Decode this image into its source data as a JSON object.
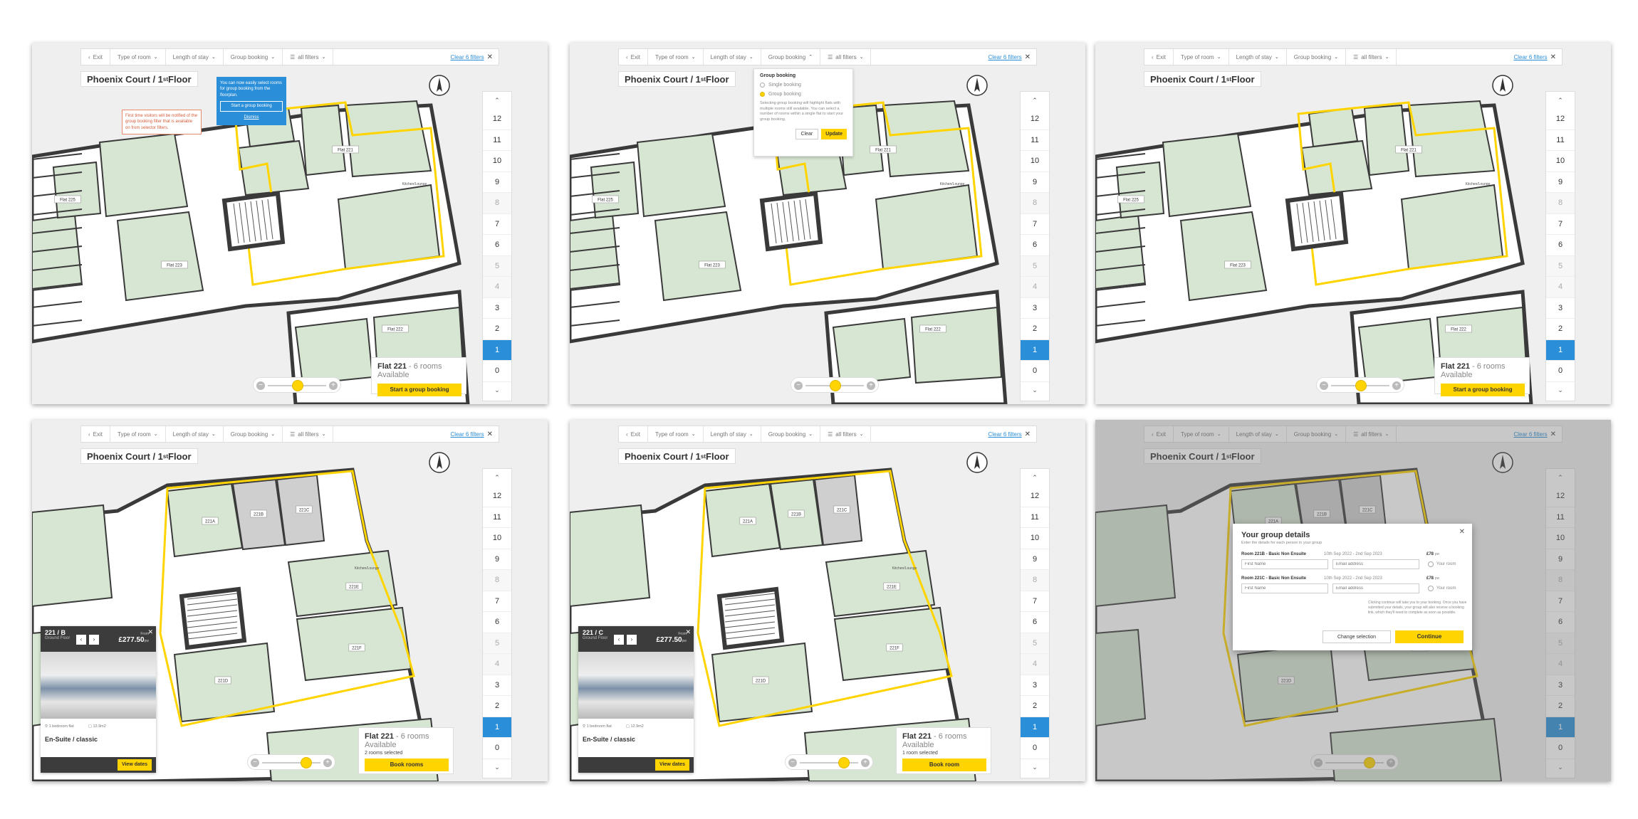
{
  "toolbar": {
    "exit": "Exit",
    "type_of_room": "Type of room",
    "length_of_stay": "Length of stay",
    "group_booking": "Group booking",
    "all_filters": "all filters",
    "clear_filters": "Clear 6 filters"
  },
  "page_title": "Phoenix Court / 1",
  "page_title_sup": "st",
  "page_title_end": " Floor",
  "floors": [
    "12",
    "11",
    "10",
    "9",
    "8",
    "7",
    "6",
    "5",
    "4",
    "3",
    "2",
    "1",
    "0"
  ],
  "floors_dim": [
    "8",
    "5",
    "4"
  ],
  "active_floor": "1",
  "flat_labels": {
    "f221": "Flat 221",
    "f225": "Flat 225",
    "f223": "Flat 223",
    "f222": "Flat 222",
    "kitchen": "Kitchen/Lounge"
  },
  "room_labels": {
    "r221a": "221A",
    "r221b": "221B",
    "r221c": "221C",
    "r221e": "221E",
    "r221f": "221F",
    "r221d": "221D"
  },
  "panel1": {
    "tooltip_text": "You can now easily select rooms for group booking from the floorplan.",
    "tooltip_button": "Start a group booking",
    "tooltip_dismiss": "Dismiss",
    "note_text": "First time visitors will be notified of the group booking filter that is available on from selector filters.",
    "card_title": "Flat 221",
    "card_suffix": " - 6 rooms Available",
    "card_button": "Start a group booking"
  },
  "panel2": {
    "dropdown_title": "Group booking",
    "option_single": "Single booking",
    "option_group": "Group booking",
    "dropdown_desc": "Selecting group booking will highlight flats with multiple rooms still available. You can select a number of rooms within a single flat to start your group booking.",
    "clear_button": "Clear",
    "update_button": "Update"
  },
  "panel3": {
    "card_title": "Flat 221",
    "card_suffix": " - 6 rooms Available",
    "card_button": "Start a group booking"
  },
  "panel4": {
    "room_name": "221 / B",
    "room_floor": "Ground Floor",
    "from_label": "From",
    "price": "£277.50",
    "price_unit": "pw",
    "meta_bed": "1 bedroom flat",
    "meta_size": "12.9m2",
    "room_type": "En-Suite / classic",
    "view_dates": "View dates",
    "card_title": "Flat 221",
    "card_suffix": " - 6 rooms Available",
    "card_sub": "2 rooms selected",
    "card_button": "Book rooms"
  },
  "panel5": {
    "room_name": "221 / C",
    "room_floor": "Ground Floor",
    "from_label": "From",
    "price": "£277.50",
    "price_unit": "pw",
    "meta_bed": "1 bedroom flat",
    "meta_size": "12.9m2",
    "room_type": "En-Suite / classic",
    "view_dates": "View dates",
    "card_title": "Flat 221",
    "card_suffix": " - 6 rooms Available",
    "card_sub": "1 room selected",
    "card_button": "Book room"
  },
  "panel6": {
    "modal_title": "Your group details",
    "modal_sub": "Enter the details for each person in your group",
    "rows": [
      {
        "room": "Room 221B - Basic Non Ensuite",
        "dates": "10th Sep 2022 - 2nd Sep 2023",
        "price": "£78",
        "unit": "pw"
      },
      {
        "room": "Room 221C - Basic Non Ensuite",
        "dates": "10th Sep 2022 - 2nd Sep 2023",
        "price": "£78",
        "unit": "pw"
      }
    ],
    "first_name": "First Name",
    "email": "Email address",
    "your_room": "Your room",
    "info": "Clicking continue will take you to your booking. Once you have submitted your details, your group will also receive a booking link, which they'll need to complete as soon as possible.",
    "change_button": "Change selection",
    "continue_button": "Continue"
  },
  "colors": {
    "accent_yellow": "#ffd400",
    "accent_blue": "#2a8ed8",
    "room_green": "#d7e6d2",
    "selected_grey": "#cfcfcf",
    "wall": "#3a3a3a"
  }
}
